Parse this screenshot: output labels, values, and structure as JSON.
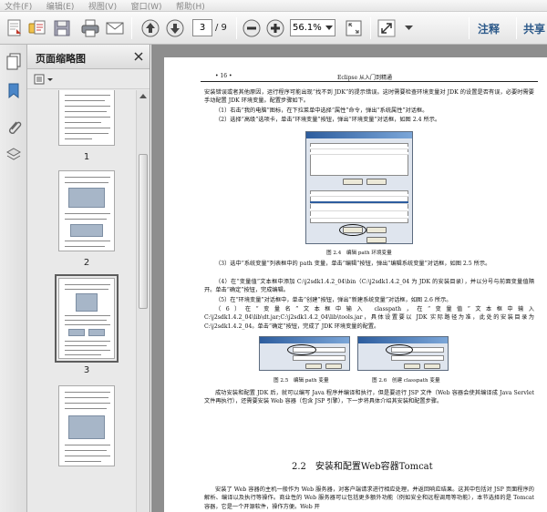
{
  "menubar": {
    "items": [
      "文件(F)",
      "编辑(E)",
      "视图(V)",
      "窗口(W)",
      "帮助(H)"
    ]
  },
  "toolbar": {
    "page_current": "3",
    "page_total": "/ 9",
    "zoom": "56.1%",
    "annotate_label": "注释",
    "share_label": "共享"
  },
  "panel": {
    "title": "页面缩略图"
  },
  "thumbnails": [
    {
      "label": "1"
    },
    {
      "label": "2"
    },
    {
      "label": "3",
      "selected": true
    },
    {
      "label": ""
    }
  ],
  "document": {
    "header_left": "• 16 •",
    "header_center": "Eclipse 从入门到精通",
    "para1": "安装错误或者其他原因，运行程序可能出现“找不到 JDK”的提示错误。这时需要检查环境变量对 JDK 的设置是否有误，必要时需要手动配置 JDK 环境变量。配置步骤如下。",
    "step1": "（1）右击“我的电脑”图标，在下拉菜单中选择“属性”命令，弹出“系统属性”对话框。",
    "step2": "（2）选择“高级”选项卡，单击“环境变量”按钮，弹出“环境变量”对话框，如图 2.4 所示。",
    "fig24_caption": "图 2.4　编辑 path 环境变量",
    "step3": "（3）选中“系统变量”列表框中的 path 变量，单击“编辑”按钮，弹出“编辑系统变量”对话框，如图 2.5 所示。",
    "step4": "（4）在“变量值”文本框中添加 C:\\j2sdk1.4.2_04\\bin（C:\\j2sdk1.4.2_04 为 JDK 的安装目录），并以分号与前面变量值隔开。单击“确定”按钮，完成编辑。",
    "step5": "（5）在“环境变量”对话框中，单击“创建”按钮，弹出“新建系统变量”对话框，如图 2.6 所示。",
    "step6": "（6）在“变量名”文本框中输入 classpath，在“变量值”文本框中输入 C:\\j2sdk1.4.2_04\\lib\\dt.jar;C:\\j2sdk1.4.2_04\\lib\\tools.jar，具体设置要以 JDK 实际路径为准，此处的安装目录为 C:\\j2sdk1.4.2_04。单击“确定”按钮，完成了 JDK 环境变量的配置。",
    "fig25_caption": "图 2.5　编辑 path 变量",
    "fig26_caption": "图 2.6　创建 classpath 变量",
    "para_done": "成功安装和配置 JDK 后，就可以编写 Java 程序并编译和执行，但是要运行 JSP 文件（Web 容器会使其编译成 Java Servlet 文件再执行），还需要安装 Web 容器（包含 JSP 引擎），下一步将具体介绍其安装和配置步骤。",
    "section_title": "2.2　安装和配置Web容器Tomcat",
    "para_last": "安装了 Web 容器的主机一般作为 Web 服务器，对客户端请求进行相应处理，并返回响应结果。这其中包括对 JSP 页面程序的解析、编译以及执行等操作。商业性的 Web 服务器可以包括更多额外功能（例如安全和远程调用等功能），本节选择的是 Tomcat 容器，它是一个开源软件，操作方便。Web 开"
  },
  "colors": {
    "accent": "#2d5a8a",
    "doc_background": "#8e8e8e",
    "panel_background": "#e9e9e9"
  }
}
